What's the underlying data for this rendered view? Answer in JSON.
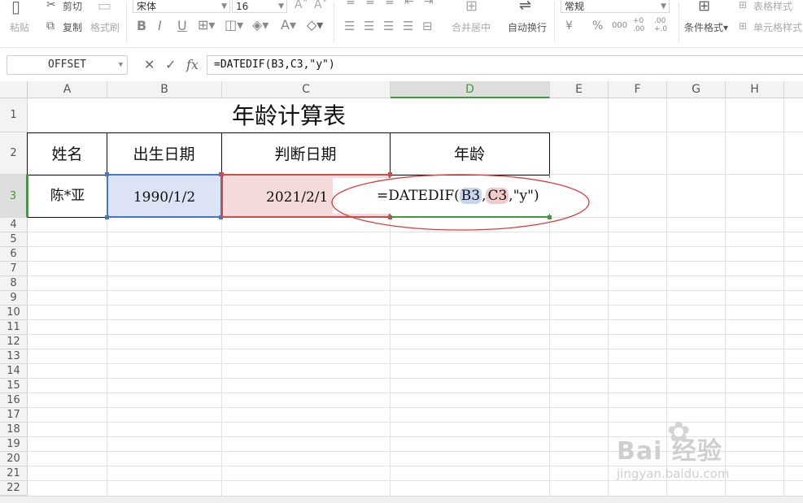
{
  "ribbon": {
    "clipboard": {
      "paste": "粘贴",
      "cut": "剪切",
      "copy": "复制",
      "format_painter": "格式刷"
    },
    "font": {
      "family": "宋体",
      "size": "16",
      "bold": "B",
      "italic": "I",
      "underline": "U"
    },
    "alignment": {
      "merge_center": "合并居中",
      "wrap_text": "自动换行"
    },
    "number": {
      "format": "常规",
      "currency": "¥",
      "percent": "%",
      "thousands": "000",
      "inc_decimal": "+0 .00",
      "dec_decimal": ".00 +.0"
    },
    "styles": {
      "conditional_format": "条件格式",
      "table_style": "表格样式",
      "cell_style": "单元格样式"
    }
  },
  "formula_bar": {
    "name_box": "OFFSET",
    "cancel": "✕",
    "confirm": "✓",
    "fx": "fx",
    "formula": "=DATEDIF(B3,C3,\"y\")"
  },
  "columns": [
    "A",
    "B",
    "C",
    "D",
    "E",
    "F",
    "G",
    "H"
  ],
  "rows": [
    "1",
    "2",
    "3",
    "4",
    "5",
    "6",
    "7",
    "8",
    "9",
    "10",
    "11",
    "12",
    "13",
    "14",
    "15",
    "16",
    "17",
    "18",
    "19",
    "20",
    "21",
    "22"
  ],
  "sheet": {
    "title": "年龄计算表",
    "headers": {
      "name": "姓名",
      "birth": "出生日期",
      "judge": "判断日期",
      "age": "年龄"
    },
    "row3": {
      "name": "陈*亚",
      "birth": "1990/1/2",
      "judge": "2021/2/1"
    },
    "edit_formula": {
      "prefix": "=DATEDIF(",
      "ref1": "B3",
      "sep1": ",",
      "ref2": "C3",
      "suffix": ",\"y\")"
    }
  },
  "watermark": {
    "brand": "Bai 经验",
    "site": "jingyan.baidu.com"
  },
  "colors": {
    "selected": "#3d9b3d",
    "ref_blue": "#4a74c9",
    "ref_red": "#cc4b4b",
    "annotation": "#e03a3a"
  }
}
